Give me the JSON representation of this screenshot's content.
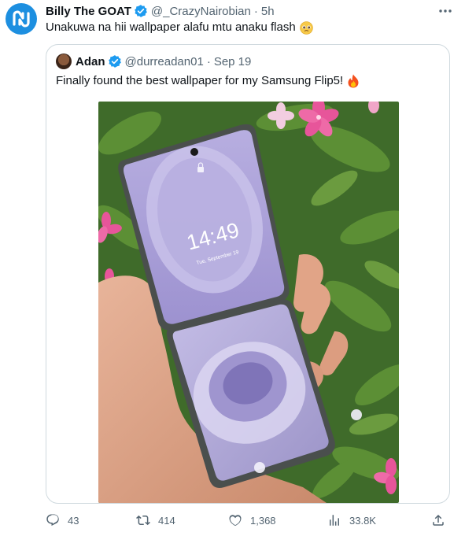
{
  "tweet": {
    "author_name": "Billy The GOAT",
    "handle": "@_CrazyNairobian",
    "separator": "·",
    "time": "5h",
    "text": "Unakuwa na hii wallpaper alafu mtu anaku flash"
  },
  "quoted": {
    "author_name": "Adan",
    "handle": "@durreadan01",
    "separator": "·",
    "date": "Sep 19",
    "text": "Finally found the best wallpaper for my Samsung Flip5!",
    "phone_screen": {
      "time": "14:49",
      "date": "Tue, September 19"
    }
  },
  "actions": {
    "replies": "43",
    "reposts": "414",
    "likes": "1,368",
    "views": "33.8K"
  },
  "icons": {
    "avatar": "app-logo-icon",
    "verified": "verified-badge-icon",
    "more": "more-options-icon",
    "reply": "reply-icon",
    "repost": "repost-icon",
    "like": "heart-icon",
    "views": "views-icon",
    "share": "share-icon"
  },
  "colors": {
    "verified_blue": "#1d9bf0",
    "muted_text": "#536471",
    "border": "#cfd9de"
  }
}
